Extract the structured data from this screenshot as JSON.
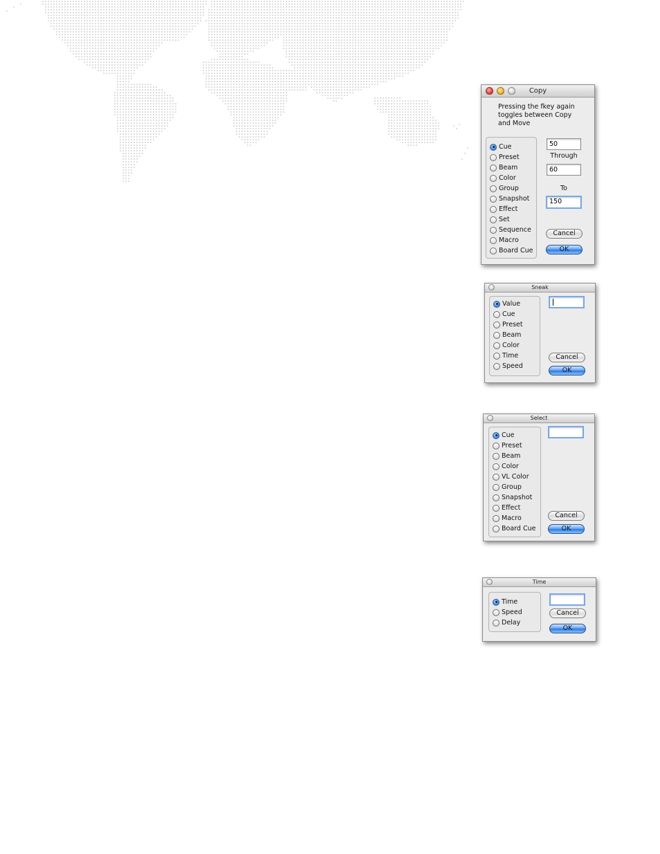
{
  "background": {
    "map_dot_color": "#d4d4d4"
  },
  "copy_dialog": {
    "title": "Copy",
    "message_lines": [
      "Pressing the fkey again",
      "toggles between Copy",
      "and Move"
    ],
    "options": [
      "Cue",
      "Preset",
      "Beam",
      "Color",
      "Group",
      "Snapshot",
      "Effect",
      "Set",
      "Sequence",
      "Macro",
      "Board Cue"
    ],
    "selected": "Cue",
    "from_value": "50",
    "through_label": "Through",
    "through_value": "60",
    "to_label": "To",
    "to_value": "150",
    "cancel_label": "Cancel",
    "ok_label": "OK"
  },
  "sneak_dialog": {
    "title": "Sneak",
    "options": [
      "Value",
      "Cue",
      "Preset",
      "Beam",
      "Color",
      "Time",
      "Speed"
    ],
    "selected": "Value",
    "input_value": "",
    "cancel_label": "Cancel",
    "ok_label": "OK"
  },
  "select_dialog": {
    "title": "Select",
    "options": [
      "Cue",
      "Preset",
      "Beam",
      "Color",
      "VL Color",
      "Group",
      "Snapshot",
      "Effect",
      "Macro",
      "Board Cue"
    ],
    "selected": "Cue",
    "input_value": "",
    "cancel_label": "Cancel",
    "ok_label": "OK"
  },
  "time_dialog": {
    "title": "Time",
    "options": [
      "Time",
      "Speed",
      "Delay"
    ],
    "selected": "Time",
    "input_value": "",
    "cancel_label": "Cancel",
    "ok_label": "OK"
  }
}
